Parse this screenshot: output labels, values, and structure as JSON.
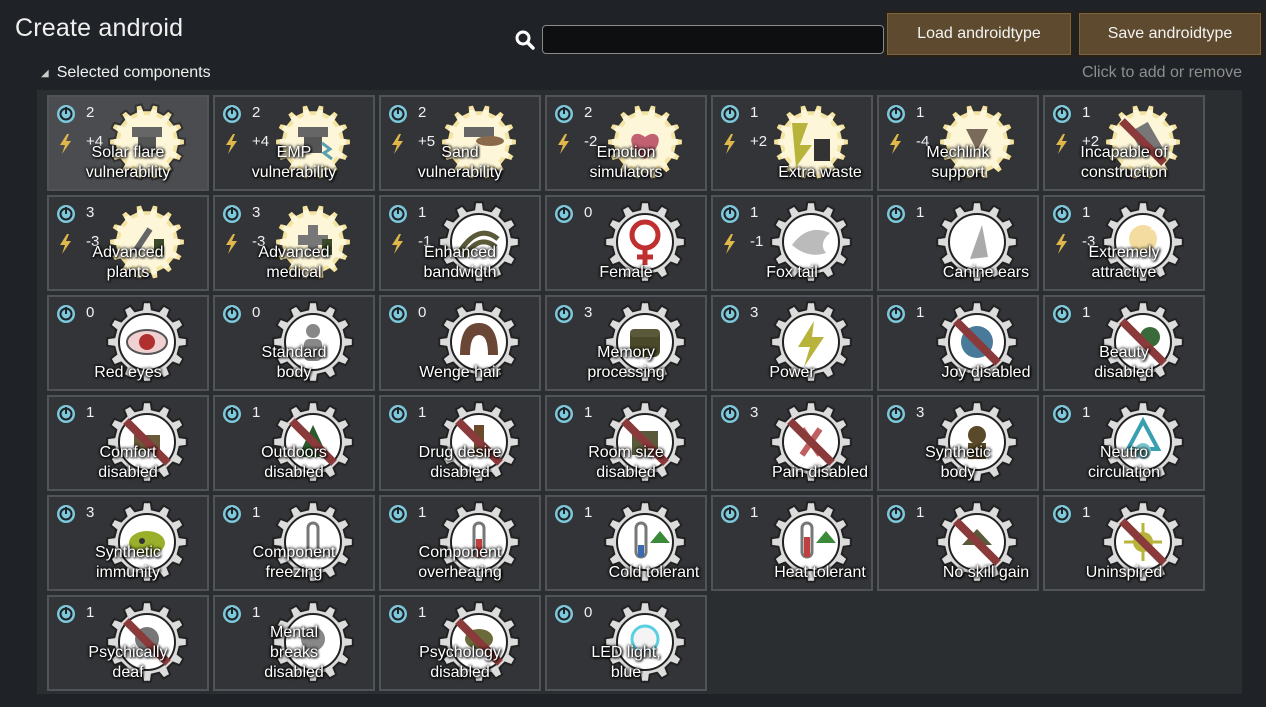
{
  "header": {
    "title": "Create android",
    "search_placeholder": "",
    "load_label": "Load androidtype",
    "save_label": "Save androidtype"
  },
  "section": {
    "label": "Selected components",
    "hint": "Click to add or remove"
  },
  "colors": {
    "circle": "#7ec8dc",
    "bolt": "#e0b84a",
    "gear": "#ececec",
    "button": "#5e4a2e"
  },
  "components": [
    {
      "name": "Solar flare\nvulnerability",
      "cost": "2",
      "power": "+4",
      "icon": "solar-flare-icon",
      "motif": "yellow"
    },
    {
      "name": "EMP\nvulnerability",
      "cost": "2",
      "power": "+4",
      "icon": "emp-icon",
      "motif": "yellow"
    },
    {
      "name": "Sand\nvulnerability",
      "cost": "2",
      "power": "+5",
      "icon": "sand-icon",
      "motif": "yellow"
    },
    {
      "name": "Emotion\nsimulators",
      "cost": "2",
      "power": "-2",
      "icon": "heart-icon",
      "motif": "yellow"
    },
    {
      "name": "Extra waste",
      "cost": "1",
      "power": "+2",
      "icon": "trash-icon",
      "motif": "yellow"
    },
    {
      "name": "Mechlink\nsupport",
      "cost": "1",
      "power": "-4",
      "icon": "mechlink-icon",
      "motif": "yellow"
    },
    {
      "name": "Incapable of\nconstruction",
      "cost": "1",
      "power": "+2",
      "icon": "hammer-icon",
      "motif": "yellow"
    },
    {
      "name": "Advanced\nplants",
      "cost": "3",
      "power": "-3",
      "icon": "plant-icon",
      "motif": "yellow"
    },
    {
      "name": "Advanced\nmedical",
      "cost": "3",
      "power": "-3",
      "icon": "medical-icon",
      "motif": "yellow"
    },
    {
      "name": "Enhanced\nbandwidth",
      "cost": "1",
      "power": "-1",
      "icon": "bandwidth-icon",
      "motif": "gear"
    },
    {
      "name": "Female",
      "cost": "0",
      "power": "",
      "icon": "female-icon",
      "motif": "gear"
    },
    {
      "name": "Fox tail",
      "cost": "1",
      "power": "-1",
      "icon": "fox-tail-icon",
      "motif": "gear"
    },
    {
      "name": "Canine ears",
      "cost": "1",
      "power": "",
      "icon": "canine-ears-icon",
      "motif": "gear"
    },
    {
      "name": "Extremely\nattractive",
      "cost": "1",
      "power": "-3",
      "icon": "attractive-icon",
      "motif": "gear"
    },
    {
      "name": "Red eyes",
      "cost": "0",
      "power": "",
      "icon": "eye-icon",
      "motif": "gear"
    },
    {
      "name": "Standard\nbody",
      "cost": "0",
      "power": "",
      "icon": "body-icon",
      "motif": "gear"
    },
    {
      "name": "Wenge hair",
      "cost": "0",
      "power": "",
      "icon": "hair-icon",
      "motif": "gear"
    },
    {
      "name": "Memory\nprocessing",
      "cost": "3",
      "power": "",
      "icon": "memory-icon",
      "motif": "gear"
    },
    {
      "name": "Power",
      "cost": "3",
      "power": "",
      "icon": "lightning-icon",
      "motif": "gear"
    },
    {
      "name": "Joy disabled",
      "cost": "1",
      "power": "",
      "icon": "joy-disabled-icon",
      "motif": "gear"
    },
    {
      "name": "Beauty\ndisabled",
      "cost": "1",
      "power": "",
      "icon": "beauty-disabled-icon",
      "motif": "gear"
    },
    {
      "name": "Comfort\ndisabled",
      "cost": "1",
      "power": "",
      "icon": "comfort-disabled-icon",
      "motif": "gear"
    },
    {
      "name": "Outdoors\ndisabled",
      "cost": "1",
      "power": "",
      "icon": "outdoors-disabled-icon",
      "motif": "gear"
    },
    {
      "name": "Drug desire\ndisabled",
      "cost": "1",
      "power": "",
      "icon": "drug-disabled-icon",
      "motif": "gear"
    },
    {
      "name": "Room size\ndisabled",
      "cost": "1",
      "power": "",
      "icon": "room-disabled-icon",
      "motif": "gear"
    },
    {
      "name": "Pain disabled",
      "cost": "3",
      "power": "",
      "icon": "pain-disabled-icon",
      "motif": "gear"
    },
    {
      "name": "Synthetic\nbody",
      "cost": "3",
      "power": "",
      "icon": "synthetic-body-icon",
      "motif": "gear"
    },
    {
      "name": "Neutro\ncirculation",
      "cost": "1",
      "power": "",
      "icon": "neutro-icon",
      "motif": "gear"
    },
    {
      "name": "Synthetic\nimmunity",
      "cost": "3",
      "power": "",
      "icon": "immunity-icon",
      "motif": "gear"
    },
    {
      "name": "Component\nfreezing",
      "cost": "1",
      "power": "",
      "icon": "freezing-icon",
      "motif": "gear"
    },
    {
      "name": "Component\noverheating",
      "cost": "1",
      "power": "",
      "icon": "overheating-icon",
      "motif": "gear"
    },
    {
      "name": "Cold tolerant",
      "cost": "1",
      "power": "",
      "icon": "cold-tolerant-icon",
      "motif": "gear"
    },
    {
      "name": "Heat tolerant",
      "cost": "1",
      "power": "",
      "icon": "heat-tolerant-icon",
      "motif": "gear"
    },
    {
      "name": "No skill gain",
      "cost": "1",
      "power": "",
      "icon": "no-skill-icon",
      "motif": "gear"
    },
    {
      "name": "Uninspired",
      "cost": "1",
      "power": "",
      "icon": "uninspired-icon",
      "motif": "gear"
    },
    {
      "name": "Psychically\ndeaf",
      "cost": "1",
      "power": "",
      "icon": "psychic-deaf-icon",
      "motif": "gear"
    },
    {
      "name": "Mental\nbreaks\ndisabled",
      "cost": "1",
      "power": "",
      "icon": "mental-breaks-icon",
      "motif": "gear"
    },
    {
      "name": "Psychology\ndisabled",
      "cost": "1",
      "power": "",
      "icon": "psychology-disabled-icon",
      "motif": "gear"
    },
    {
      "name": "LED light,\nblue",
      "cost": "0",
      "power": "",
      "icon": "led-light-icon",
      "motif": "gear"
    }
  ]
}
